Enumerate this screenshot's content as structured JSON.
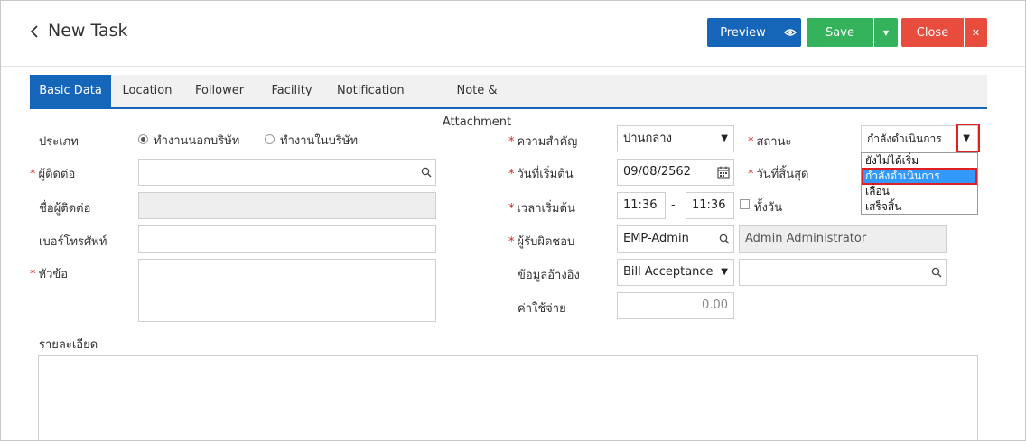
{
  "header": {
    "title": "New Task",
    "preview_label": "Preview",
    "save_label": "Save",
    "close_label": "Close"
  },
  "colors": {
    "primary": "#1565b8",
    "save": "#35b35c",
    "close": "#e74c3c",
    "required": "#d12626",
    "highlight": "#e02020",
    "selected": "#3399ff"
  },
  "tabs": [
    {
      "label": "Basic Data",
      "active": true
    },
    {
      "label": "Location"
    },
    {
      "label": "Follower"
    },
    {
      "label": "Facility"
    },
    {
      "label": "Notification"
    },
    {
      "label": "Note & Attachment"
    }
  ],
  "form": {
    "type_label": "ประเภท",
    "type_opt1": "ทำงานนอกบริษัท",
    "type_opt2": "ทำงานในบริษัท",
    "contact_label": "ผู้ติดต่อ",
    "contact_value": "",
    "contact_name_label": "ชื่อผู้ติดต่อ",
    "phone_label": "เบอร์โทรศัพท์",
    "subject_label": "หัวข้อ",
    "priority_label": "ความสำคัญ",
    "priority_value": "ปานกลาง",
    "start_date_label": "วันที่เริ่มต้น",
    "start_date_value": "09/08/2562",
    "start_time_label": "เวลาเริ่มต้น",
    "start_time_value": "11:36",
    "time_separator": "-",
    "end_time_value": "11:36",
    "allday_label": "ทั้งวัน",
    "responsible_label": "ผู้รับผิดชอบ",
    "responsible_code": "EMP-Admin",
    "responsible_name": "Admin Administrator",
    "reference_label": "ข้อมูลอ้างอิง",
    "reference_value": "Bill Acceptance",
    "expense_label": "ค่าใช้จ่าย",
    "expense_value": "0.00",
    "status_label": "สถานะ",
    "status_value": "กำลังดำเนินการ",
    "status_options": [
      "ยังไม่ได้เริ่ม",
      "กำลังดำเนินการ",
      "เลื่อน",
      "เสร็จสิ้น"
    ],
    "end_date_label": "วันที่สิ้นสุด",
    "detail_label": "รายละเอียด"
  }
}
